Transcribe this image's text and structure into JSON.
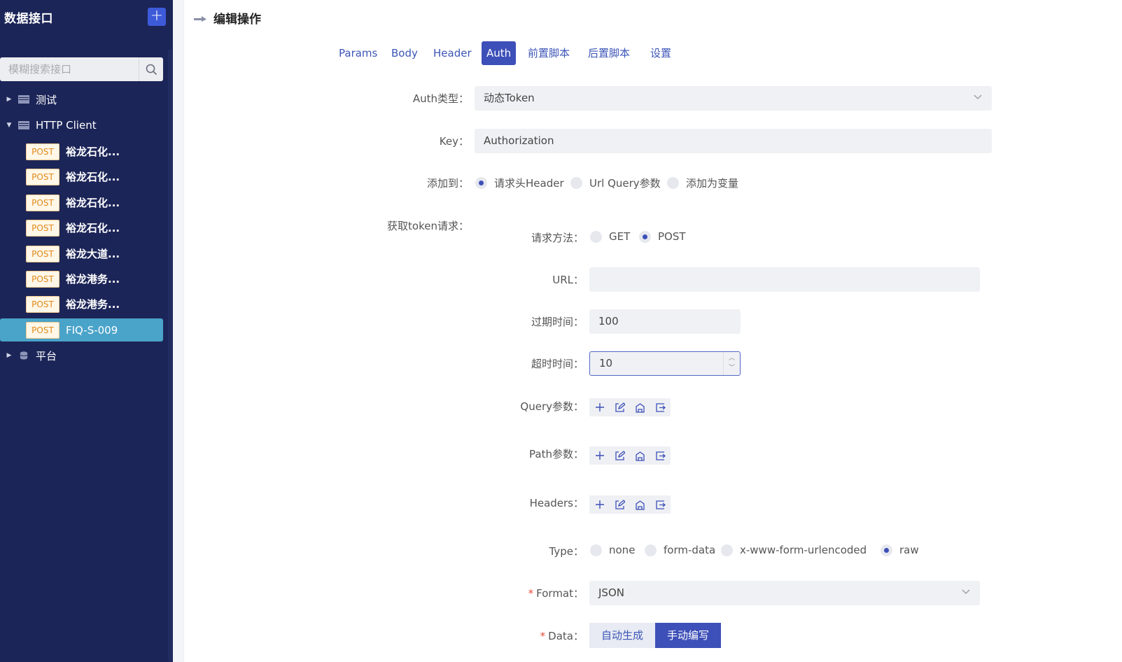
{
  "sidebar": {
    "title": "数据接口",
    "add_label": "+",
    "search_placeholder": "模糊搜索接口",
    "groups": [
      {
        "label": "测试",
        "expanded": false
      },
      {
        "label": "HTTP Client",
        "expanded": true
      },
      {
        "label": "平台",
        "expanded": false
      }
    ],
    "items": [
      {
        "method": "POST",
        "label": "裕龙石化..."
      },
      {
        "method": "POST",
        "label": "裕龙石化..."
      },
      {
        "method": "POST",
        "label": "裕龙石化..."
      },
      {
        "method": "POST",
        "label": "裕龙石化..."
      },
      {
        "method": "POST",
        "label": "裕龙大道..."
      },
      {
        "method": "POST",
        "label": "裕龙港务..."
      },
      {
        "method": "POST",
        "label": "裕龙港务..."
      },
      {
        "method": "POST",
        "label": "FIQ-S-009"
      }
    ]
  },
  "header": {
    "title": "编辑操作"
  },
  "tabs": [
    "Params",
    "Body",
    "Header",
    "Auth",
    "前置脚本",
    "后置脚本",
    "设置"
  ],
  "form": {
    "auth_type_label": "Auth类型：",
    "auth_type_value": "动态Token",
    "key_label": "Key：",
    "key_value": "Authorization",
    "add_to_label": "添加到：",
    "add_to_options": [
      "请求头Header",
      "Url Query参数",
      "添加为变量"
    ],
    "token_req_label": "获取token请求：",
    "method_label": "请求方法：",
    "method_options": [
      "GET",
      "POST"
    ],
    "url_label": "URL：",
    "url_value": "",
    "expire_label": "过期时间：",
    "expire_value": "100",
    "timeout_label": "超时时间：",
    "timeout_value": "10",
    "query_label": "Query参数：",
    "path_label": "Path参数：",
    "headers_label": "Headers：",
    "type_label": "Type：",
    "type_options": [
      "none",
      "form-data",
      "x-www-form-urlencoded",
      "raw"
    ],
    "format_label": "Format：",
    "format_value": "JSON",
    "data_label": "Data：",
    "data_options": [
      "自动生成",
      "手动编写"
    ],
    "required_mark": "*"
  },
  "colors": {
    "sidebar_bg": "#1c2558",
    "accent": "#3d4fb8",
    "active_item": "#4aa3c9"
  }
}
